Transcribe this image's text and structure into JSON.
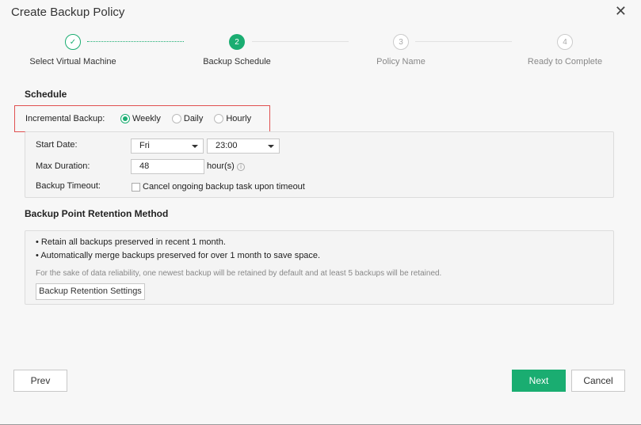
{
  "dialog": {
    "title": "Create Backup Policy",
    "close_glyph": "✕"
  },
  "steps": [
    {
      "label": "Select Virtual Machine",
      "number": "",
      "state": "done",
      "glyph": "✓"
    },
    {
      "label": "Backup Schedule",
      "number": "2",
      "state": "active"
    },
    {
      "label": "Policy Name",
      "number": "3",
      "state": "todo"
    },
    {
      "label": "Ready to Complete",
      "number": "4",
      "state": "todo"
    }
  ],
  "schedule": {
    "title": "Schedule",
    "incremental_label": "Incremental Backup:",
    "options": [
      "Weekly",
      "Daily",
      "Hourly"
    ],
    "selected": "Weekly",
    "start_date_label": "Start Date:",
    "start_day": "Fri",
    "start_time": "23:00",
    "max_duration_label": "Max Duration:",
    "max_duration_value": "48",
    "max_duration_unit": "hour(s)",
    "timeout_label": "Backup Timeout:",
    "timeout_checkbox_label": "Cancel ongoing backup task upon timeout",
    "timeout_checked": false
  },
  "retention": {
    "title": "Backup Point Retention Method",
    "bullets": [
      "Retain all backups preserved in recent 1 month.",
      "Automatically merge backups preserved for over 1 month to save space."
    ],
    "note": "For the sake of data reliability, one newest backup will be retained by default and at least 5 backups will be retained.",
    "settings_button": "Backup Retention Settings"
  },
  "footer": {
    "prev": "Prev",
    "next": "Next",
    "cancel": "Cancel"
  },
  "colors": {
    "accent": "#1aad71",
    "highlight_border": "#e05050"
  }
}
